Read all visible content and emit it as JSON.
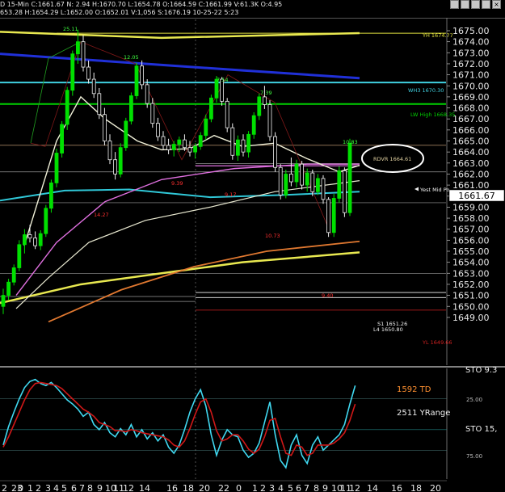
{
  "header": {
    "line1": "D 15-Min  C:1661.67  N: 2.94  H:1670.70  L:1654.78  O:1664.59  C:1661.99  V:61.3K  O:4.95",
    "line2": "653.28 H:1654.29  L:1652.00  O:1652.01  V:1,056  S:1676.19  10-25-22  5:23"
  },
  "price_axis": {
    "ticks": [
      "1675.00",
      "1674.00",
      "1673.00",
      "1672.00",
      "1671.00",
      "1670.00",
      "1669.00",
      "1668.00",
      "1667.00",
      "1666.00",
      "1665.00",
      "1664.00",
      "1663.00",
      "1662.00",
      "1661.00",
      "1660.00",
      "1659.00",
      "1658.00",
      "1657.00",
      "1656.00",
      "1655.00",
      "1654.00",
      "1653.00",
      "1652.00",
      "1651.00",
      "1650.00",
      "1649.00"
    ],
    "current": "1661.67"
  },
  "level_labels": {
    "yh": "YH 1674.77",
    "wh3": "WH3 1670.30",
    "lw_high": "LW High 1668.35",
    "rdvr": "RDVR 1664.61",
    "yest_mid": "Yest Mid Po",
    "s1": "S1 1651.26",
    "l4": "L4 1650.80",
    "yl": "YL 1649.66"
  },
  "swing_labels": [
    "25.11",
    "12.05",
    "7.54",
    "7.39",
    "10.83",
    "9.39",
    "9.17",
    "14.27",
    "10.73",
    "9.40"
  ],
  "osc": {
    "label": "STO",
    "label_top": "STO 9.3",
    "label_right": "STO 15,",
    "td": "1592 TD",
    "yrange": "2511 YRange",
    "level_hi": "25.00",
    "level_lo": "75.00"
  },
  "time_axis": [
    "2",
    "23",
    "0",
    "1",
    "2",
    "3",
    "4",
    "5",
    "6",
    "7",
    "8",
    "9",
    "10",
    "11",
    "12",
    "14",
    "16",
    "18",
    "20",
    "22",
    "0",
    "1",
    "2",
    "3",
    "4",
    "5",
    "6",
    "7",
    "8",
    "9",
    "10",
    "11",
    "12",
    "14",
    "16",
    "18",
    "20"
  ],
  "chart_data": {
    "type": "candlestick",
    "timeframe": "15-Min",
    "ylim": [
      1648.5,
      1676.0
    ],
    "ohlc": [
      [
        1650.0,
        1651.6,
        1649.3,
        1651.0
      ],
      [
        1651.0,
        1652.5,
        1650.6,
        1652.2
      ],
      [
        1652.2,
        1653.8,
        1651.9,
        1653.5
      ],
      [
        1653.5,
        1656.0,
        1653.2,
        1655.6
      ],
      [
        1655.6,
        1657.0,
        1654.8,
        1656.5
      ],
      [
        1656.5,
        1657.4,
        1655.8,
        1656.2
      ],
      [
        1656.2,
        1656.8,
        1655.2,
        1655.5
      ],
      [
        1655.5,
        1656.9,
        1655.1,
        1656.6
      ],
      [
        1656.6,
        1659.2,
        1656.3,
        1658.9
      ],
      [
        1658.9,
        1661.5,
        1658.5,
        1661.2
      ],
      [
        1661.2,
        1664.3,
        1660.8,
        1663.9
      ],
      [
        1663.9,
        1666.8,
        1663.5,
        1666.5
      ],
      [
        1666.5,
        1669.9,
        1666.0,
        1669.6
      ],
      [
        1669.6,
        1673.2,
        1669.1,
        1672.9
      ],
      [
        1672.9,
        1675.1,
        1672.0,
        1674.0
      ],
      [
        1674.0,
        1674.6,
        1671.3,
        1671.7
      ],
      [
        1671.7,
        1672.3,
        1670.2,
        1670.6
      ],
      [
        1670.6,
        1671.2,
        1668.9,
        1669.3
      ],
      [
        1669.3,
        1669.8,
        1667.0,
        1667.4
      ],
      [
        1667.4,
        1668.0,
        1664.6,
        1665.0
      ],
      [
        1665.0,
        1665.6,
        1662.9,
        1663.3
      ],
      [
        1663.3,
        1664.0,
        1661.5,
        1662.0
      ],
      [
        1662.0,
        1664.8,
        1661.7,
        1664.4
      ],
      [
        1664.4,
        1667.1,
        1664.1,
        1666.8
      ],
      [
        1666.8,
        1669.4,
        1666.5,
        1669.1
      ],
      [
        1669.1,
        1672.1,
        1668.8,
        1671.8
      ],
      [
        1671.8,
        1672.3,
        1669.7,
        1670.1
      ],
      [
        1670.1,
        1670.6,
        1668.0,
        1668.4
      ],
      [
        1668.4,
        1668.9,
        1666.2,
        1666.6
      ],
      [
        1666.6,
        1667.1,
        1665.0,
        1665.4
      ],
      [
        1665.4,
        1665.9,
        1664.2,
        1664.6
      ],
      [
        1664.6,
        1665.2,
        1663.8,
        1664.2
      ],
      [
        1664.2,
        1665.0,
        1663.6,
        1664.7
      ],
      [
        1664.7,
        1665.4,
        1664.0,
        1665.1
      ],
      [
        1665.1,
        1665.6,
        1664.1,
        1664.4
      ],
      [
        1664.4,
        1665.0,
        1663.6,
        1664.0
      ],
      [
        1664.0,
        1664.8,
        1663.4,
        1664.5
      ],
      [
        1664.5,
        1665.8,
        1664.2,
        1665.5
      ],
      [
        1665.5,
        1667.4,
        1665.1,
        1667.0
      ],
      [
        1667.0,
        1669.2,
        1666.7,
        1668.9
      ],
      [
        1668.9,
        1670.9,
        1668.5,
        1670.6
      ],
      [
        1670.6,
        1670.8,
        1668.2,
        1668.6
      ],
      [
        1668.6,
        1668.9,
        1665.8,
        1666.2
      ],
      [
        1666.2,
        1666.6,
        1663.3,
        1663.7
      ],
      [
        1663.7,
        1665.5,
        1663.2,
        1665.1
      ],
      [
        1665.1,
        1665.6,
        1663.6,
        1664.0
      ],
      [
        1664.0,
        1665.9,
        1663.5,
        1665.6
      ],
      [
        1665.6,
        1667.6,
        1665.2,
        1667.3
      ],
      [
        1667.3,
        1669.3,
        1666.9,
        1669.0
      ],
      [
        1669.0,
        1670.0,
        1667.9,
        1668.3
      ],
      [
        1668.3,
        1668.7,
        1665.0,
        1665.4
      ],
      [
        1665.4,
        1665.8,
        1662.2,
        1662.6
      ],
      [
        1662.6,
        1662.9,
        1659.7,
        1660.1
      ],
      [
        1660.1,
        1662.4,
        1659.8,
        1662.0
      ],
      [
        1662.0,
        1663.5,
        1660.9,
        1661.3
      ],
      [
        1661.3,
        1663.3,
        1660.8,
        1662.9
      ],
      [
        1662.9,
        1663.2,
        1660.6,
        1661.0
      ],
      [
        1661.0,
        1662.5,
        1660.4,
        1662.1
      ],
      [
        1662.1,
        1662.4,
        1660.0,
        1660.4
      ],
      [
        1660.4,
        1662.0,
        1660.1,
        1661.6
      ],
      [
        1661.6,
        1661.9,
        1659.3,
        1659.7
      ],
      [
        1659.7,
        1659.9,
        1656.3,
        1656.7
      ],
      [
        1656.7,
        1660.2,
        1656.3,
        1659.8
      ],
      [
        1659.8,
        1662.7,
        1659.4,
        1662.3
      ],
      [
        1662.3,
        1662.6,
        1658.1,
        1658.5
      ],
      [
        1658.5,
        1665.2,
        1658.2,
        1664.8
      ]
    ],
    "reference_levels": {
      "YH": 1674.77,
      "WH3": 1670.3,
      "LW High": 1668.35,
      "RDVR": 1664.61,
      "S1": 1651.26,
      "L4": 1650.8,
      "YL": 1649.66
    },
    "last_price": 1661.67,
    "oscillator": {
      "name": "STO",
      "levels": [
        25.0,
        75.0
      ],
      "series": [
        {
          "name": "fast",
          "color": "#40d8f0",
          "values": [
            70,
            52,
            38,
            25,
            14,
            8,
            6,
            10,
            12,
            9,
            14,
            20,
            26,
            30,
            35,
            42,
            38,
            50,
            55,
            48,
            58,
            62,
            54,
            60,
            50,
            62,
            55,
            64,
            58,
            66,
            60,
            72,
            78,
            70,
            55,
            38,
            25,
            16,
            32,
            60,
            80,
            65,
            55,
            60,
            62,
            75,
            82,
            78,
            68,
            48,
            28,
            60,
            85,
            92,
            70,
            60,
            80,
            88,
            70,
            62,
            75,
            70,
            65,
            60,
            50,
            30,
            12
          ]
        },
        {
          "name": "slow",
          "color": "#d01818",
          "values": [
            72,
            62,
            50,
            38,
            26,
            16,
            10,
            9,
            10,
            11,
            12,
            15,
            20,
            25,
            30,
            35,
            38,
            42,
            48,
            50,
            52,
            56,
            56,
            57,
            55,
            56,
            58,
            59,
            60,
            61,
            62,
            65,
            70,
            72,
            66,
            54,
            40,
            28,
            25,
            38,
            56,
            66,
            64,
            60,
            60,
            66,
            74,
            78,
            74,
            62,
            46,
            44,
            62,
            78,
            80,
            70,
            72,
            80,
            78,
            70,
            70,
            70,
            68,
            64,
            58,
            46,
            30
          ]
        }
      ]
    },
    "moving_averages": [
      {
        "name": "yellow",
        "color": "#e8e850"
      },
      {
        "name": "blue",
        "color": "#2030d8"
      },
      {
        "name": "cyan",
        "color": "#30c8d8"
      },
      {
        "name": "magenta",
        "color": "#e070e0"
      },
      {
        "name": "orange",
        "color": "#e07830"
      },
      {
        "name": "white",
        "color": "#f0f0d8"
      }
    ]
  },
  "colors": {
    "background": "#000000",
    "up_candle": "#00e000",
    "down_candle": "#f0f0f0",
    "wh3": "#40d0e0",
    "lw_high": "#00d000",
    "yh": "#e0e040",
    "yl": "#d02020",
    "swing_up": "#40ff40",
    "swing_down": "#ff3030",
    "td": "#ff9030"
  }
}
